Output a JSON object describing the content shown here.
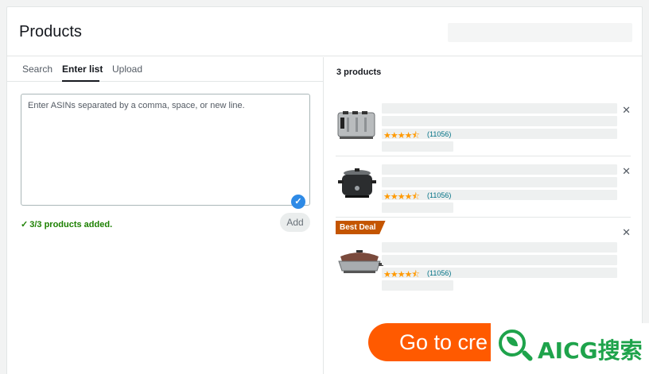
{
  "header": {
    "title": "Products"
  },
  "tabs": [
    {
      "label": "Search"
    },
    {
      "label": "Enter list"
    },
    {
      "label": "Upload"
    }
  ],
  "list_input": {
    "placeholder": "Enter ASINs separated by a comma, space, or new line.",
    "value": ""
  },
  "status": {
    "text": "3/3 products added."
  },
  "add_label": "Add",
  "products": {
    "count_label": "3 products",
    "items": [
      {
        "icon": "toaster",
        "rating": 4.5,
        "stars": "★★★★⯪",
        "reviews": "(11056)",
        "badge": ""
      },
      {
        "icon": "slow-cooker",
        "rating": 4.5,
        "stars": "★★★★⯪",
        "reviews": "(11056)",
        "badge": ""
      },
      {
        "icon": "electric-skillet",
        "rating": 4.5,
        "stars": "★★★★⯪",
        "reviews": "(11056)",
        "badge": "Best Deal"
      }
    ]
  },
  "cta": {
    "label": "Go to cre"
  },
  "watermark": {
    "text": "AICG搜索"
  },
  "colors": {
    "accent_blue": "#2e8ae6",
    "success_green": "#1d8102",
    "star_orange": "#ff9900",
    "review_link": "#007185",
    "deal_badge": "#c45500",
    "cta_orange": "#ff5a00",
    "watermark_green": "#1ea34b"
  }
}
